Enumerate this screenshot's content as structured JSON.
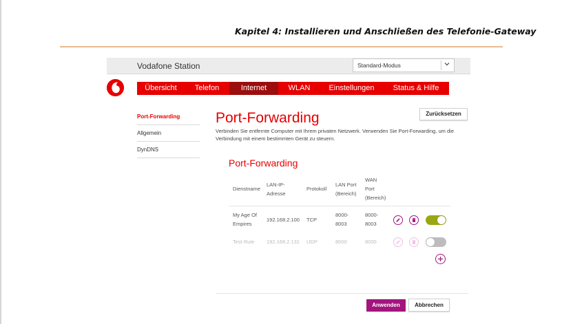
{
  "document": {
    "chapter_title": "Kapitel 4: Installieren und Anschließen des Telefonie-Gateway"
  },
  "header": {
    "brand": "Vodafone Station",
    "mode": "Standard-Modus"
  },
  "nav": {
    "items": [
      "Übersicht",
      "Telefon",
      "Internet",
      "WLAN",
      "Einstellungen",
      "Status & Hilfe"
    ],
    "active": "Internet"
  },
  "sidebar": {
    "items": [
      "Port-Forwarding",
      "Allgemein",
      "DynDNS"
    ],
    "active": "Port-Forwarding"
  },
  "main": {
    "title": "Port-Forwarding",
    "reset_label": "Zurücksetzen",
    "intro": "Verbinden Sie entfernte Computer mit Ihrem privaten Netzwerk. Verwenden Sie Port-Forwarding, um die Verbindung mit einem bestimmten Gerät zu steuern.",
    "section_title": "Port-Forwarding"
  },
  "table": {
    "headers": [
      "Dienstname",
      "LAN-IP-Adresse",
      "Protokoll",
      "LAN Port (Bereich)",
      "WAN Port (Bereich)"
    ],
    "rows": [
      {
        "name": "My Age Of Empires",
        "ip": "192.168.2.100",
        "protocol": "TCP",
        "lan_port": "8000-8003",
        "wan_port": "8000-8003",
        "enabled": true
      },
      {
        "name": "Test Rule",
        "ip": "192.168.2.131",
        "protocol": "UDP",
        "lan_port": "8000",
        "wan_port": "8000",
        "enabled": false
      }
    ]
  },
  "footer": {
    "apply_label": "Anwenden",
    "cancel_label": "Abbrechen"
  },
  "colors": {
    "brand_red": "#e60000",
    "nav_active": "#9c0d0d",
    "accent_purple": "#a3147e",
    "toggle_on": "#9aa712",
    "toggle_off": "#bdbdbd"
  },
  "icons": {
    "logo": "vodafone-logo",
    "edit": "pencil-icon",
    "delete": "trash-icon",
    "add": "plus-icon",
    "dropdown": "chevron-down-icon"
  }
}
